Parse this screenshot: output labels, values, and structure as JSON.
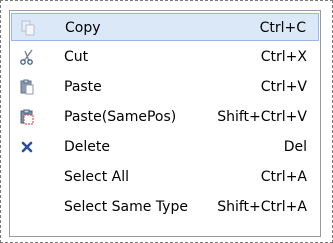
{
  "menu": {
    "items": [
      {
        "label": "Copy",
        "shortcut": "Ctrl+C",
        "icon": "copy-icon",
        "selected": true
      },
      {
        "label": "Cut",
        "shortcut": "Ctrl+X",
        "icon": "cut-icon"
      },
      {
        "label": "Paste",
        "shortcut": "Ctrl+V",
        "icon": "paste-icon"
      },
      {
        "label": "Paste(SamePos)",
        "shortcut": "Shift+Ctrl+V",
        "icon": "paste-same-position-icon"
      },
      {
        "label": "Delete",
        "shortcut": "Del",
        "icon": "delete-icon"
      },
      {
        "label": "Select All",
        "shortcut": "Ctrl+A",
        "icon": ""
      },
      {
        "label": "Select Same Type",
        "shortcut": "Shift+Ctrl+A",
        "icon": ""
      }
    ]
  },
  "colors": {
    "highlight": "#dbe8f8",
    "highlight_border": "#97b8e2",
    "delete_icon": "#2b4f9c"
  }
}
